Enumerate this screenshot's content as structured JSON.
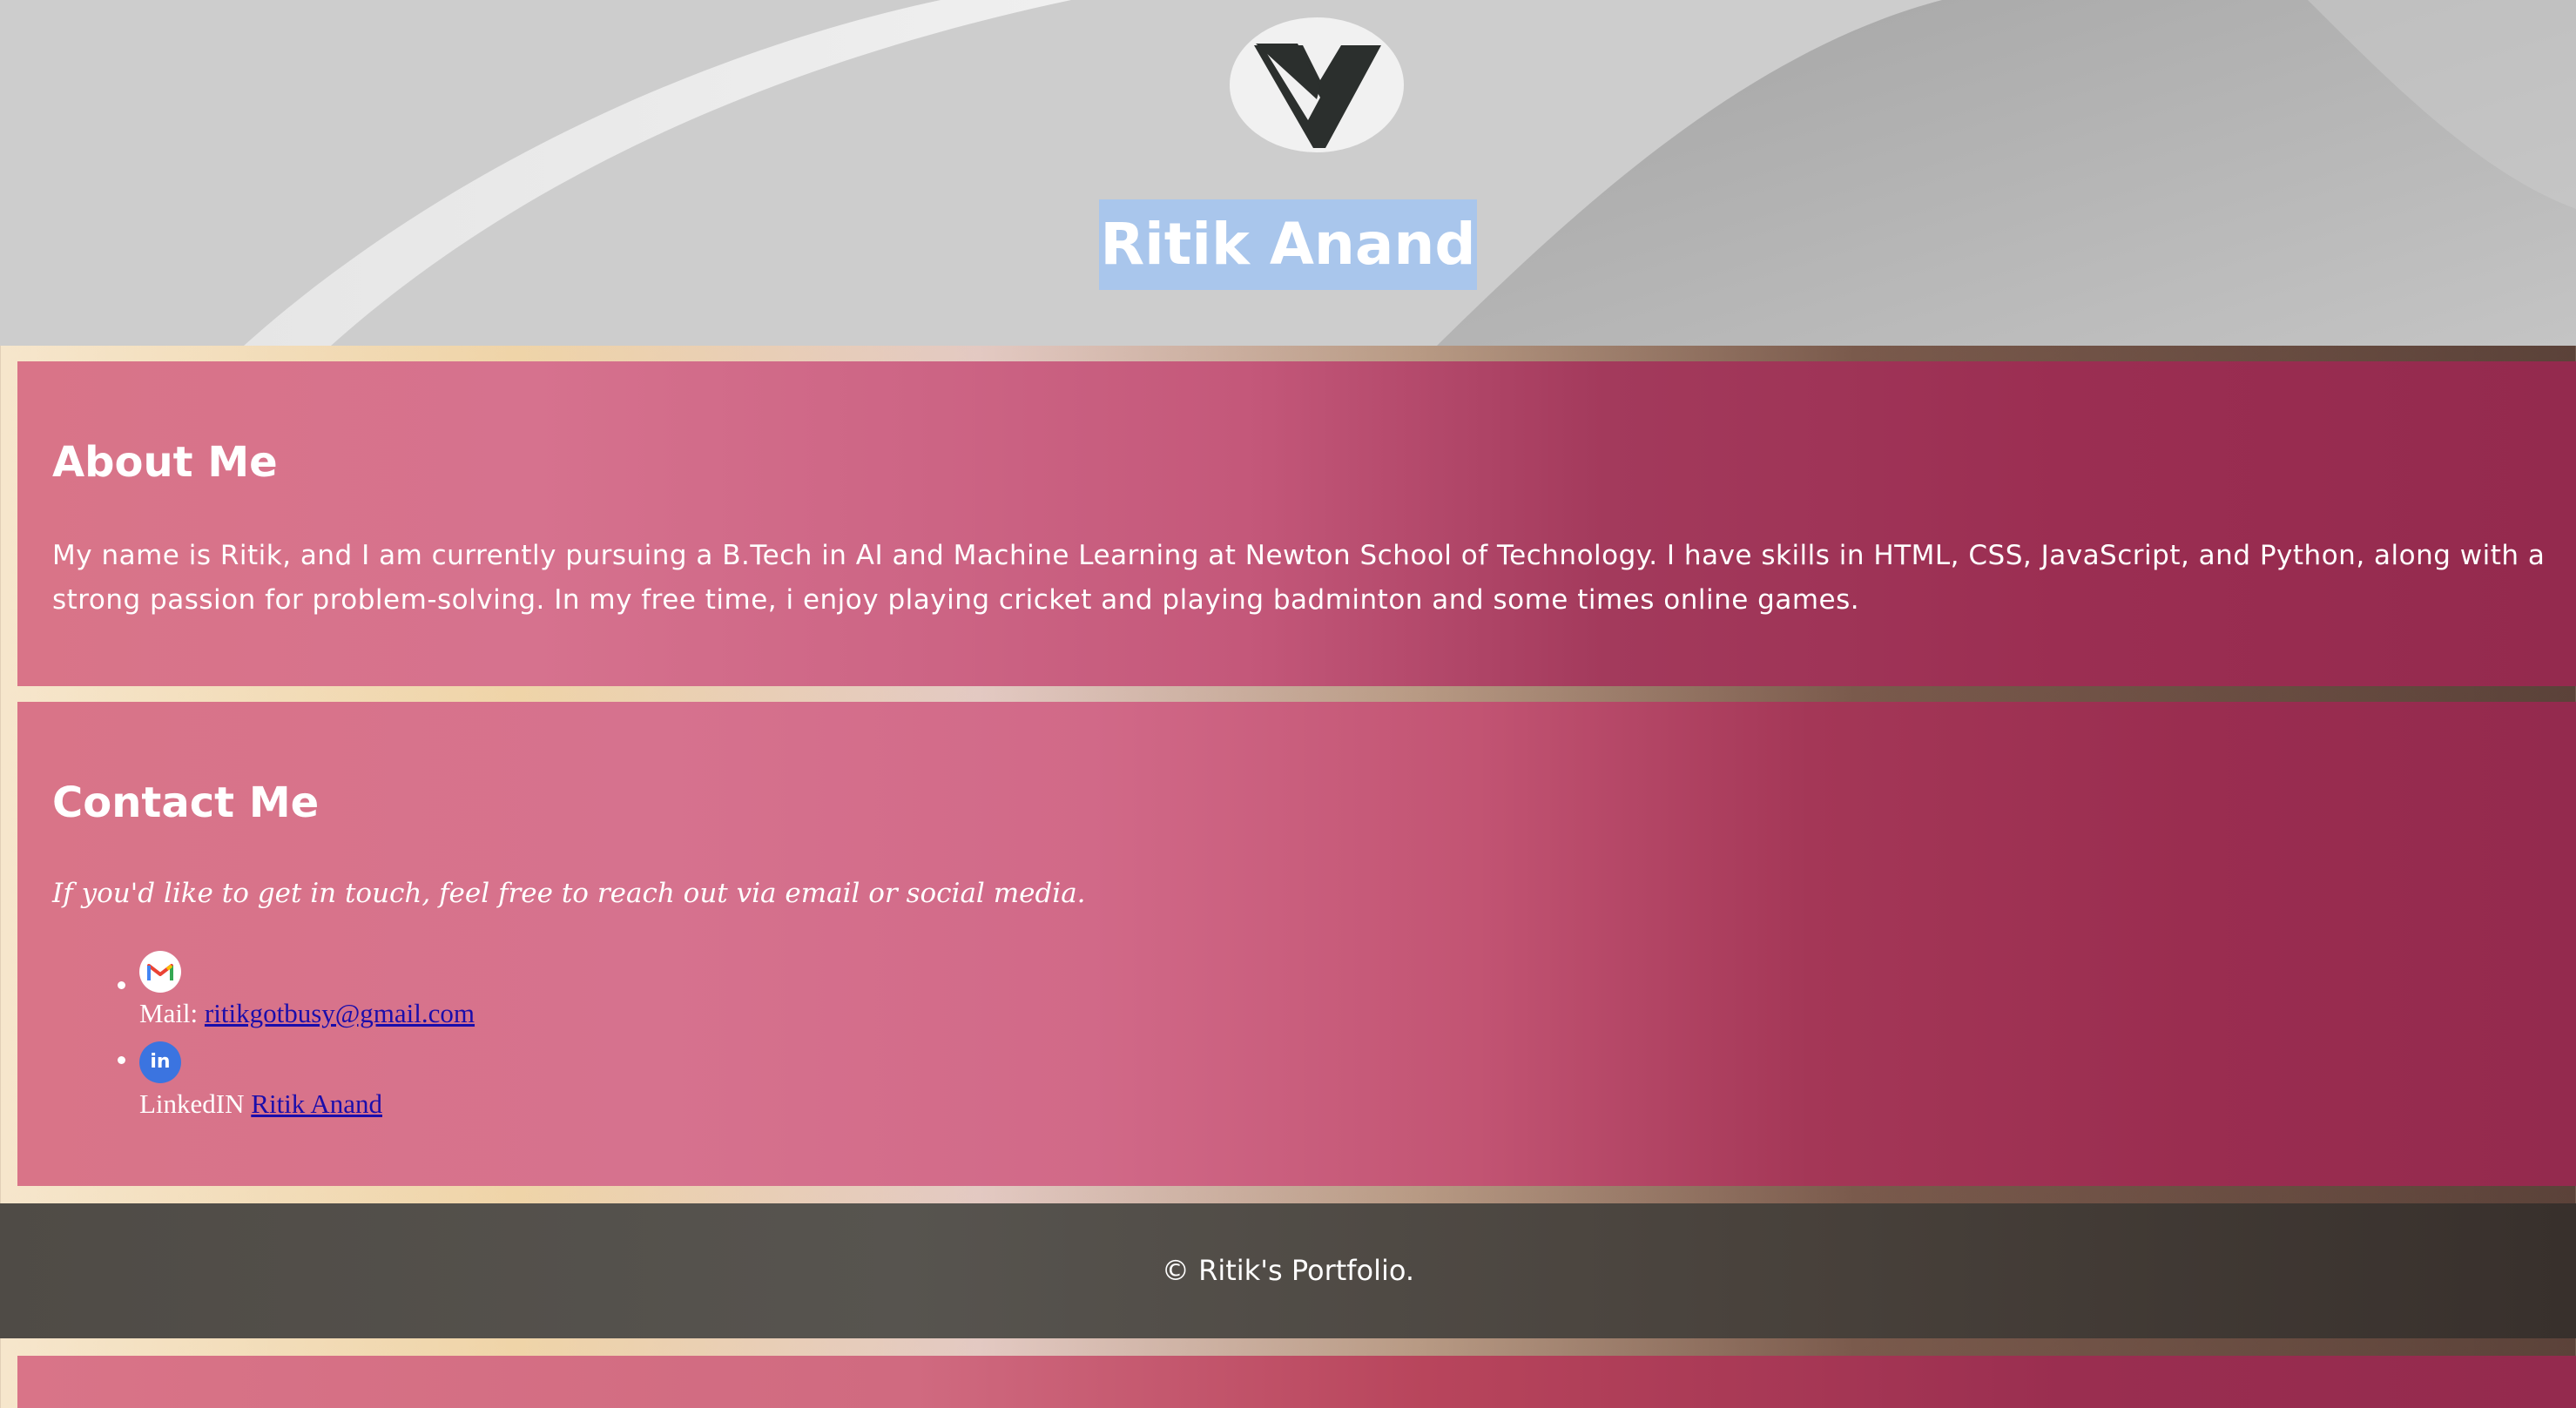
{
  "header": {
    "logo_icon": "v7-logo-icon",
    "title": "Ritik Anand"
  },
  "about": {
    "heading": "About Me",
    "text": "My name is Ritik, and I am currently pursuing a B.Tech in AI and Machine Learning at Newton School of Technology. I have skills in HTML, CSS, JavaScript, and Python, along with a strong passion for problem-solving. In my free time, i enjoy playing cricket and playing badminton and some times online games."
  },
  "contact": {
    "heading": "Contact Me",
    "intro": "If you'd like to get in touch, feel free to reach out via email or social media.",
    "items": [
      {
        "icon": "gmail-icon",
        "label": "Mail:",
        "link_text": "ritikgotbusy@gmail.com"
      },
      {
        "icon": "linkedin-icon",
        "label": "LinkedIN",
        "link_text": "Ritik Anand",
        "icon_text": "in"
      }
    ]
  },
  "footer": {
    "text": "© Ritik's Portfolio."
  },
  "colors": {
    "title_highlight": "#a9c6ec",
    "panel_left": "#d97488",
    "panel_right": "#942a4e",
    "link": "#1a0dab",
    "linkedin_blue": "#3b74e0"
  }
}
